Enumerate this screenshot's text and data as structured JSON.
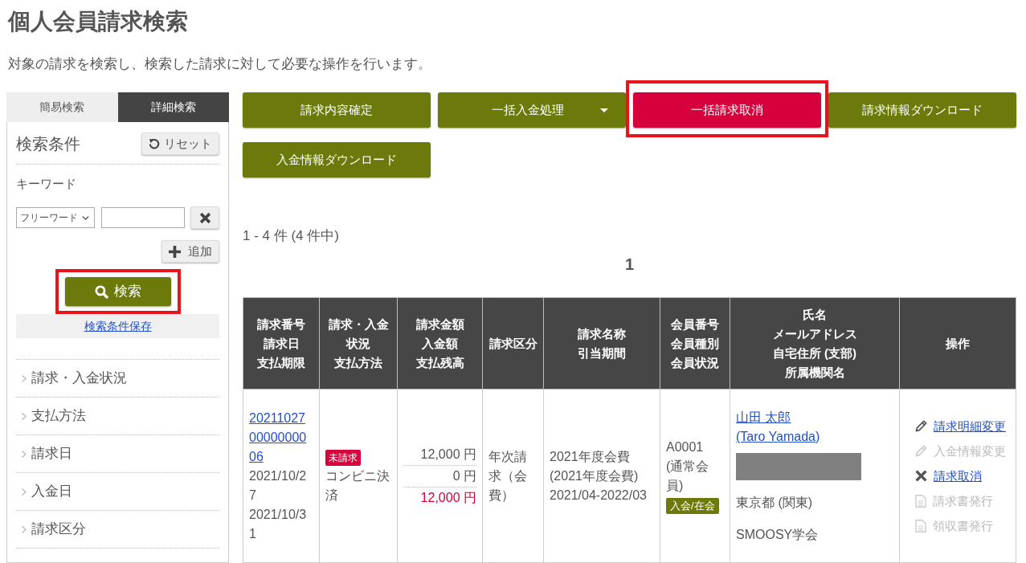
{
  "page": {
    "title": "個人会員請求検索",
    "description": "対象の請求を検索し、検索した請求に対して必要な操作を行います。"
  },
  "search_tabs": [
    {
      "label": "簡易検索",
      "selected": false
    },
    {
      "label": "詳細検索",
      "selected": true
    }
  ],
  "search_panel": {
    "title": "検索条件",
    "reset_button": "リセット",
    "keyword_label": "キーワード",
    "keyword_select": "フリーワード",
    "add_button": "追加",
    "search_button": {
      "label": "検索",
      "highlighted": true
    },
    "save_link": "検索条件保存",
    "filters": [
      {
        "label": "請求・入金状況",
        "expanded": false
      },
      {
        "label": "支払方法",
        "expanded": false
      },
      {
        "label": "請求日",
        "expanded": false
      },
      {
        "label": "入金日",
        "expanded": false
      },
      {
        "label": "請求区分",
        "expanded": false
      }
    ]
  },
  "actions": [
    {
      "label": "請求内容確定",
      "kind": "plain",
      "highlighted": false
    },
    {
      "label": "一括入金処理",
      "kind": "dropdown",
      "highlighted": false
    },
    {
      "label": "一括請求取消",
      "kind": "danger",
      "highlighted": true
    },
    {
      "label": "請求情報ダウンロード",
      "kind": "plain",
      "highlighted": false
    },
    {
      "label": "入金情報ダウンロード",
      "kind": "plain",
      "highlighted": false
    }
  ],
  "result_count": "1 - 4 件 (4 件中)",
  "pagination": [
    {
      "label": "1",
      "selected": true
    }
  ],
  "table": {
    "columns": [
      {
        "lines": [
          "請求番号",
          "請求日",
          "支払期限"
        ]
      },
      {
        "lines": [
          "請求・入金",
          "状況",
          "支払方法"
        ]
      },
      {
        "lines": [
          "請求金額",
          "入金額",
          "支払残高"
        ]
      },
      {
        "lines": [
          "請求区分"
        ]
      },
      {
        "lines": [
          "請求名称",
          "引当期間"
        ]
      },
      {
        "lines": [
          "会員番号",
          "会員種別",
          "会員状況"
        ]
      },
      {
        "lines": [
          "氏名",
          "メールアドレス",
          "自宅住所 (支部)",
          "所属機関名"
        ]
      },
      {
        "lines": [
          "操作"
        ]
      }
    ],
    "rows": [
      {
        "invoice_number": "202110270000000006",
        "billing_date": "2021/10/27",
        "due_date": "2021/10/31",
        "status": {
          "label": "未請求",
          "kind": "unbilled"
        },
        "payment_method": "コンビニ決済",
        "amounts": [
          {
            "label": "12,000 円",
            "kind": "billed"
          },
          {
            "label": "0 円",
            "kind": "paid"
          },
          {
            "label": "12,000 円",
            "kind": "balance"
          }
        ],
        "billing_type": "年次請求（会費）",
        "claim_name": "2021年度会費",
        "claim_subname": "(2021年度会費)",
        "allocation_period": "2021/04-2022/03",
        "member_number": "A0001",
        "member_type": "(通常会員)",
        "member_status": "入会/在会",
        "name_lines": [
          "山田 太郎",
          "(Taro Yamada)"
        ],
        "email_redacted": true,
        "address": "東京都 (関東)",
        "organization": "SMOOSY学会",
        "operations": [
          {
            "label": "請求明細変更",
            "kind": "edit",
            "disabled": false
          },
          {
            "label": "入金情報変更",
            "kind": "edit",
            "disabled": true
          },
          {
            "label": "請求取消",
            "kind": "cancel",
            "disabled": false
          },
          {
            "label": "請求書発行",
            "kind": "document",
            "disabled": true
          },
          {
            "label": "領収書発行",
            "kind": "document",
            "disabled": true
          }
        ]
      }
    ]
  }
}
